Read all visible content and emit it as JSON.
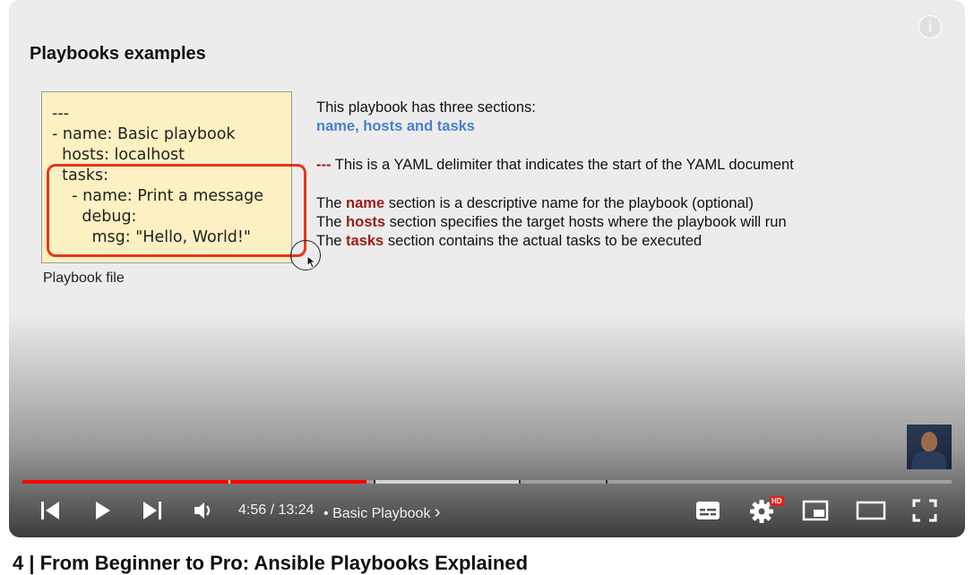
{
  "slide": {
    "title": "Playbooks examples",
    "code_lines": [
      "---",
      "- name: Basic playbook",
      "  hosts: localhost",
      "  tasks:",
      "    - name: Print a message",
      "      debug:",
      "        msg: \"Hello, World!\""
    ],
    "file_label": "Playbook file",
    "intro": "This playbook has three sections:",
    "sections_line": "name, hosts and tasks",
    "delimiter_mark": "---",
    "delimiter_text": " This is a YAML delimiter that indicates the start of the YAML document",
    "lines": [
      {
        "prefix": "The ",
        "keyword": "name",
        "rest": " section is a descriptive name for the playbook (optional)"
      },
      {
        "prefix": "The ",
        "keyword": "hosts",
        "rest": " section specifies the target hosts where the playbook will run"
      },
      {
        "prefix": "The ",
        "keyword": "tasks",
        "rest": " section contains the actual tasks to be executed"
      }
    ]
  },
  "player": {
    "info_glyph": "i",
    "current_time": "4:56",
    "separator": " / ",
    "duration": "13:24",
    "dot": "•",
    "chapter": "Basic Playbook",
    "chapter_chevron": "›",
    "hd_badge": "HD",
    "progress_fraction": 0.37,
    "colors": {
      "played": "#ff0000",
      "buffered": "rgba(255,255,255,0.6)",
      "unplayed": "rgba(255,255,255,0.3)",
      "highlight": "#e8351f",
      "keyword": "#9a1c16",
      "sections_blue": "#4a7fd0",
      "code_bg": "#fdf0c2"
    },
    "icons": [
      "previous-icon",
      "play-icon",
      "next-icon",
      "volume-icon",
      "subtitles-icon",
      "settings-gear-icon",
      "miniplayer-icon",
      "theater-mode-icon",
      "fullscreen-icon",
      "info-icon"
    ]
  },
  "below": {
    "video_title": "4 | From Beginner to Pro: Ansible Playbooks Explained"
  }
}
